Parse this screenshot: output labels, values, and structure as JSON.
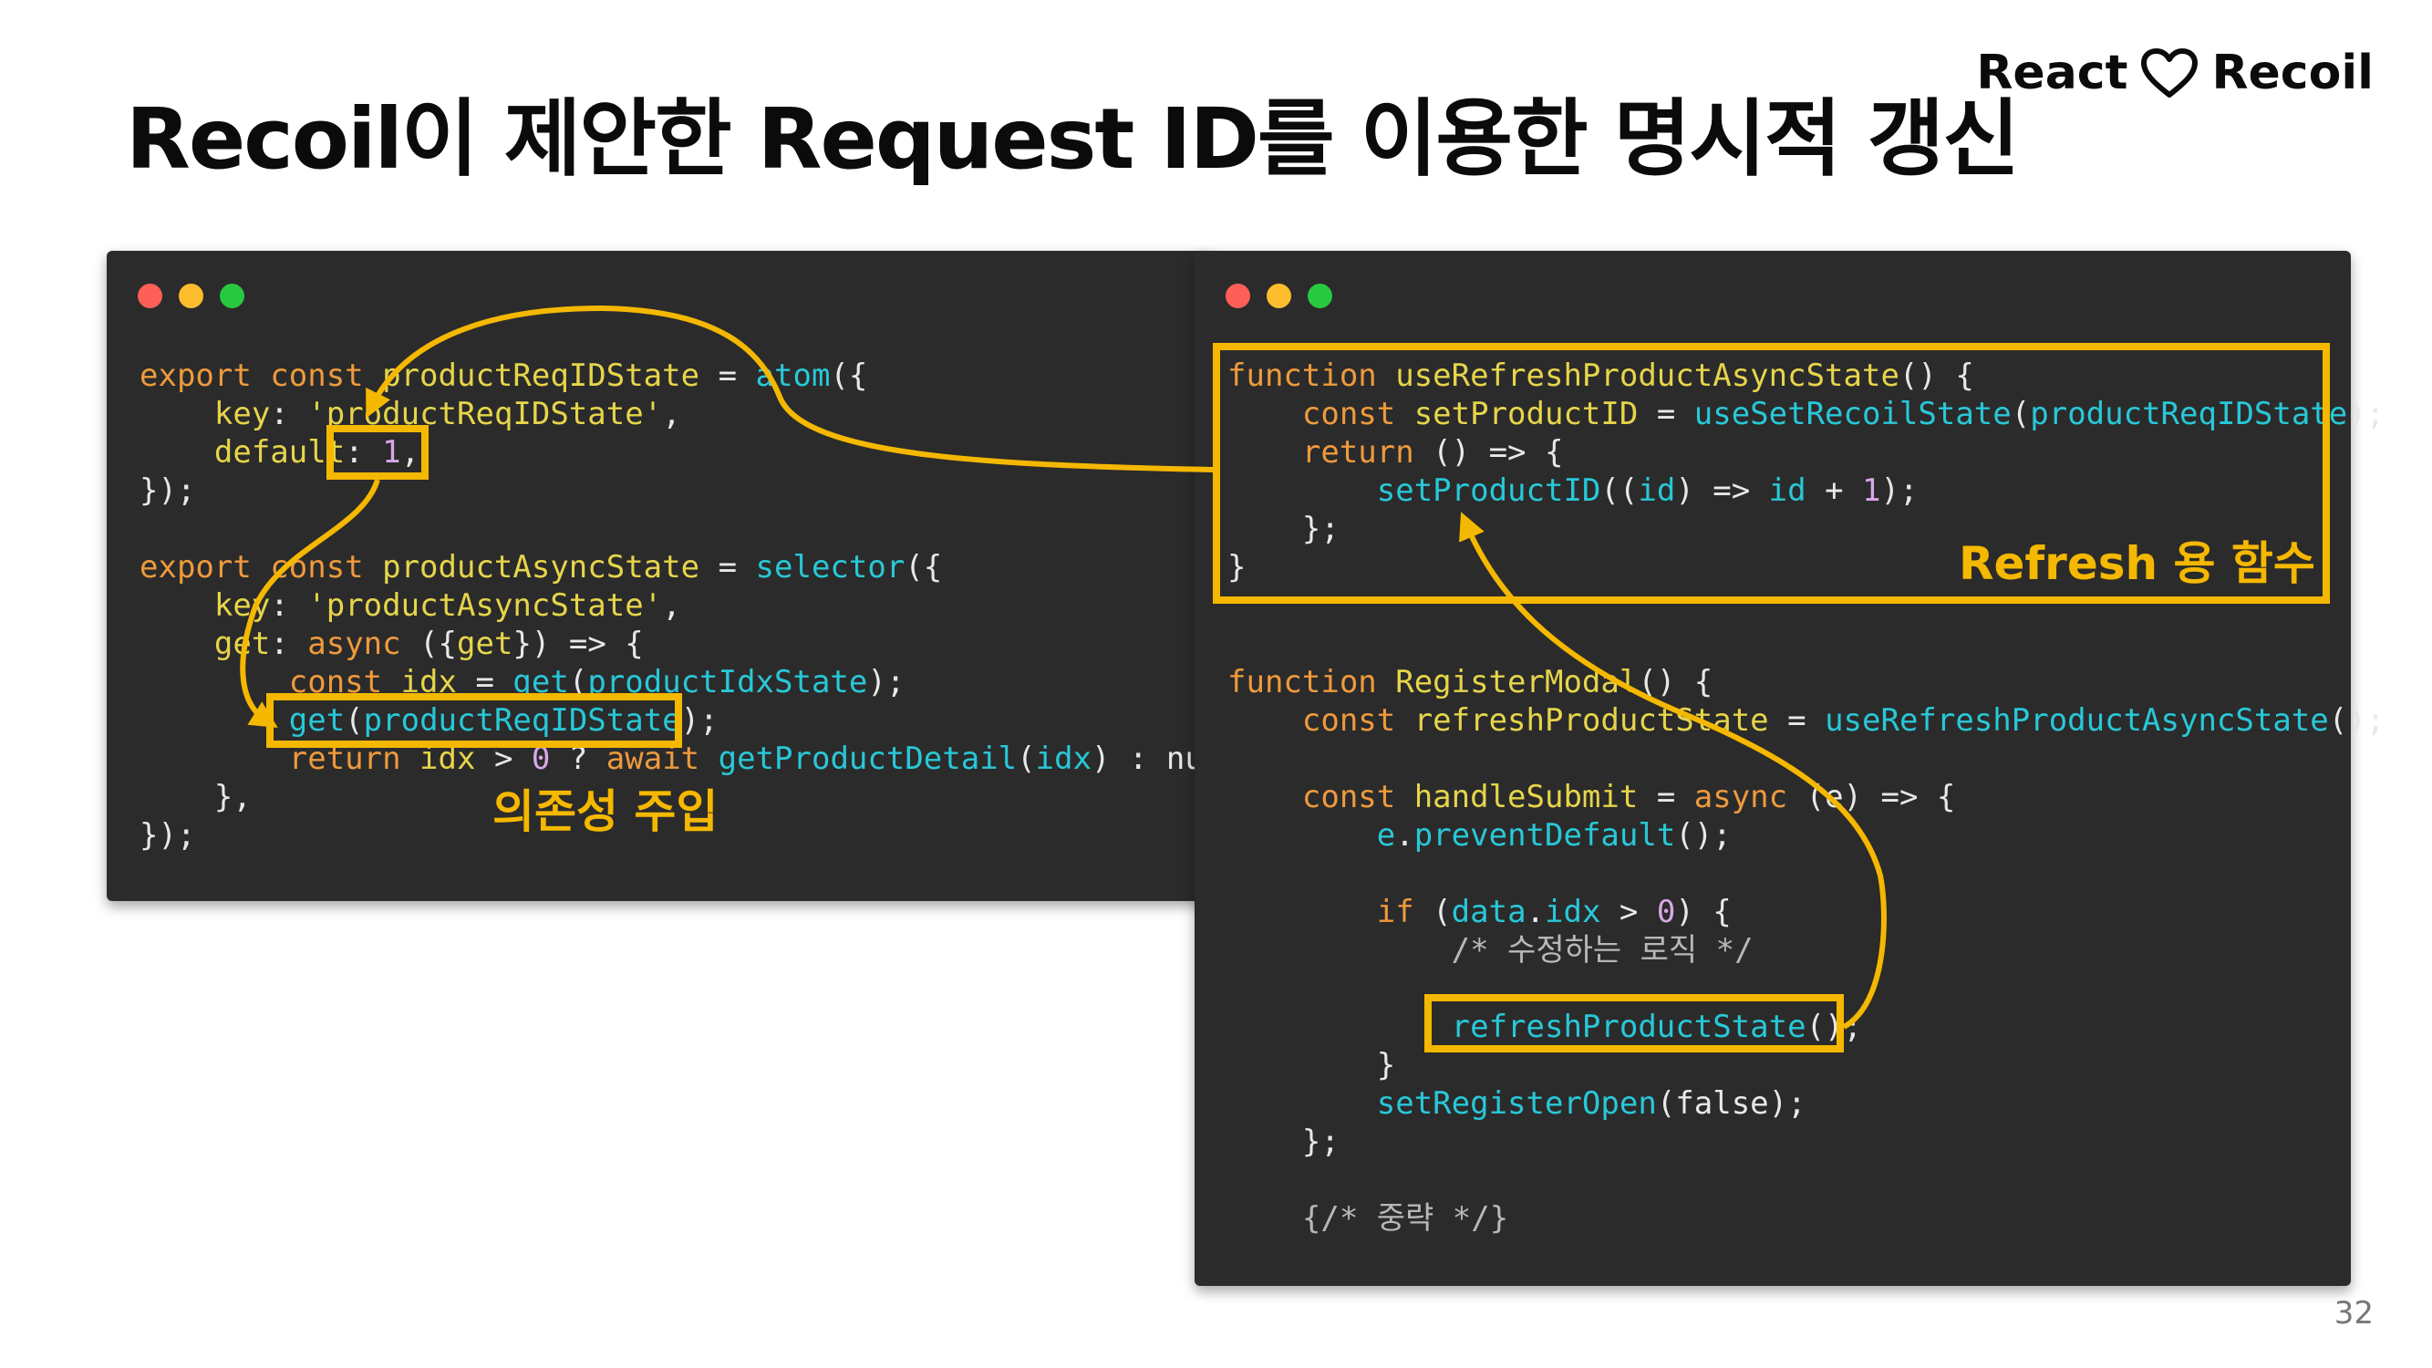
{
  "slide": {
    "title": "Recoil이 제안한 Request ID를 이용한 명시적 갱신",
    "brand_left": "React",
    "brand_icon": "heart-outline-icon",
    "brand_right": "Recoil",
    "page_number": "32"
  },
  "colors": {
    "highlight": "#f5b800",
    "editor_background": "#2b2b2b",
    "keyword": "#ee9a3c",
    "function": "#28c8d8",
    "identifier": "#e6d54a",
    "window_dots": [
      "#ff5f56",
      "#ffbd2e",
      "#27c93f"
    ]
  },
  "left_window": {
    "lines": [
      [
        {
          "t": "export const ",
          "c": "kw"
        },
        {
          "t": "productReqIDState",
          "c": "id"
        },
        {
          "t": " = ",
          "c": "pl"
        },
        {
          "t": "atom",
          "c": "fn"
        },
        {
          "t": "({",
          "c": "pl"
        }
      ],
      [
        {
          "t": "    key",
          "c": "id"
        },
        {
          "t": ": ",
          "c": "pl"
        },
        {
          "t": "'productReqIDState'",
          "c": "str"
        },
        {
          "t": ",",
          "c": "pl"
        }
      ],
      [
        {
          "t": "    default",
          "c": "id"
        },
        {
          "t": ": ",
          "c": "pl"
        },
        {
          "t": "1",
          "c": "num"
        },
        {
          "t": ",",
          "c": "pl"
        }
      ],
      [
        {
          "t": "});",
          "c": "pl"
        }
      ],
      [
        {
          "t": "",
          "c": "pl"
        }
      ],
      [
        {
          "t": "export const ",
          "c": "kw"
        },
        {
          "t": "productAsyncState",
          "c": "id"
        },
        {
          "t": " = ",
          "c": "pl"
        },
        {
          "t": "selector",
          "c": "fn"
        },
        {
          "t": "({",
          "c": "pl"
        }
      ],
      [
        {
          "t": "    key",
          "c": "id"
        },
        {
          "t": ": ",
          "c": "pl"
        },
        {
          "t": "'productAsyncState'",
          "c": "str"
        },
        {
          "t": ",",
          "c": "pl"
        }
      ],
      [
        {
          "t": "    get",
          "c": "id"
        },
        {
          "t": ": ",
          "c": "pl"
        },
        {
          "t": "async ",
          "c": "kw"
        },
        {
          "t": "({",
          "c": "pl"
        },
        {
          "t": "get",
          "c": "id"
        },
        {
          "t": "}) => {",
          "c": "pl"
        }
      ],
      [
        {
          "t": "        const ",
          "c": "kw"
        },
        {
          "t": "idx",
          "c": "id"
        },
        {
          "t": " = ",
          "c": "pl"
        },
        {
          "t": "get",
          "c": "fn"
        },
        {
          "t": "(",
          "c": "pl"
        },
        {
          "t": "productIdxState",
          "c": "fn"
        },
        {
          "t": ");",
          "c": "pl"
        }
      ],
      [
        {
          "t": "        get",
          "c": "fn"
        },
        {
          "t": "(",
          "c": "pl"
        },
        {
          "t": "productReqIDState",
          "c": "fn"
        },
        {
          "t": ");",
          "c": "pl"
        }
      ],
      [
        {
          "t": "        return ",
          "c": "kw"
        },
        {
          "t": "idx",
          "c": "id"
        },
        {
          "t": " > ",
          "c": "pl"
        },
        {
          "t": "0",
          "c": "num"
        },
        {
          "t": " ? ",
          "c": "pl"
        },
        {
          "t": "await ",
          "c": "kw"
        },
        {
          "t": "getProductDetail",
          "c": "fn"
        },
        {
          "t": "(",
          "c": "pl"
        },
        {
          "t": "idx",
          "c": "fn"
        },
        {
          "t": ") : null;",
          "c": "pl"
        }
      ],
      [
        {
          "t": "    },",
          "c": "pl"
        }
      ],
      [
        {
          "t": "});",
          "c": "pl"
        }
      ]
    ],
    "callout": "의존성 주입"
  },
  "right_window": {
    "lines": [
      [
        {
          "t": "function ",
          "c": "kw"
        },
        {
          "t": "useRefreshProductAsyncState",
          "c": "id"
        },
        {
          "t": "() {",
          "c": "pl"
        }
      ],
      [
        {
          "t": "    const ",
          "c": "kw"
        },
        {
          "t": "setProductID",
          "c": "id"
        },
        {
          "t": " = ",
          "c": "pl"
        },
        {
          "t": "useSetRecoilState",
          "c": "fn"
        },
        {
          "t": "(",
          "c": "pl"
        },
        {
          "t": "productReqIDState",
          "c": "fn"
        },
        {
          "t": ");",
          "c": "pl"
        }
      ],
      [
        {
          "t": "    return ",
          "c": "kw"
        },
        {
          "t": "() => {",
          "c": "pl"
        }
      ],
      [
        {
          "t": "        setProductID",
          "c": "fn"
        },
        {
          "t": "((",
          "c": "pl"
        },
        {
          "t": "id",
          "c": "fn"
        },
        {
          "t": ") => ",
          "c": "pl"
        },
        {
          "t": "id",
          "c": "fn"
        },
        {
          "t": " + ",
          "c": "pl"
        },
        {
          "t": "1",
          "c": "num"
        },
        {
          "t": ");",
          "c": "pl"
        }
      ],
      [
        {
          "t": "    };",
          "c": "pl"
        }
      ],
      [
        {
          "t": "}",
          "c": "pl"
        }
      ],
      [
        {
          "t": "",
          "c": "pl"
        }
      ],
      [
        {
          "t": "",
          "c": "pl"
        }
      ],
      [
        {
          "t": "function ",
          "c": "kw"
        },
        {
          "t": "RegisterModal",
          "c": "id"
        },
        {
          "t": "() {",
          "c": "pl"
        }
      ],
      [
        {
          "t": "    const ",
          "c": "kw"
        },
        {
          "t": "refreshProductState",
          "c": "id"
        },
        {
          "t": " = ",
          "c": "pl"
        },
        {
          "t": "useRefreshProductAsyncState",
          "c": "fn"
        },
        {
          "t": "();",
          "c": "pl"
        }
      ],
      [
        {
          "t": "",
          "c": "pl"
        }
      ],
      [
        {
          "t": "    const ",
          "c": "kw"
        },
        {
          "t": "handleSubmit",
          "c": "id"
        },
        {
          "t": " = ",
          "c": "pl"
        },
        {
          "t": "async ",
          "c": "kw"
        },
        {
          "t": "(e) => {",
          "c": "pl"
        }
      ],
      [
        {
          "t": "        e",
          "c": "fn"
        },
        {
          "t": ".",
          "c": "pl"
        },
        {
          "t": "preventDefault",
          "c": "fn"
        },
        {
          "t": "();",
          "c": "pl"
        }
      ],
      [
        {
          "t": "",
          "c": "pl"
        }
      ],
      [
        {
          "t": "        if ",
          "c": "kw"
        },
        {
          "t": "(",
          "c": "pl"
        },
        {
          "t": "data",
          "c": "fn"
        },
        {
          "t": ".",
          "c": "pl"
        },
        {
          "t": "idx",
          "c": "fn"
        },
        {
          "t": " > ",
          "c": "pl"
        },
        {
          "t": "0",
          "c": "num"
        },
        {
          "t": ") {",
          "c": "pl"
        }
      ],
      [
        {
          "t": "            /* 수정하는 로직 */",
          "c": "cm"
        }
      ],
      [
        {
          "t": "",
          "c": "pl"
        }
      ],
      [
        {
          "t": "            refreshProductState",
          "c": "fn"
        },
        {
          "t": "();",
          "c": "pl"
        }
      ],
      [
        {
          "t": "        }",
          "c": "pl"
        }
      ],
      [
        {
          "t": "        setRegisterOpen",
          "c": "fn"
        },
        {
          "t": "(false);",
          "c": "pl"
        }
      ],
      [
        {
          "t": "    };",
          "c": "pl"
        }
      ],
      [
        {
          "t": "",
          "c": "pl"
        }
      ],
      [
        {
          "t": "    {/* 중략 */}",
          "c": "cm"
        }
      ]
    ],
    "callout": "Refresh 용 함수"
  }
}
